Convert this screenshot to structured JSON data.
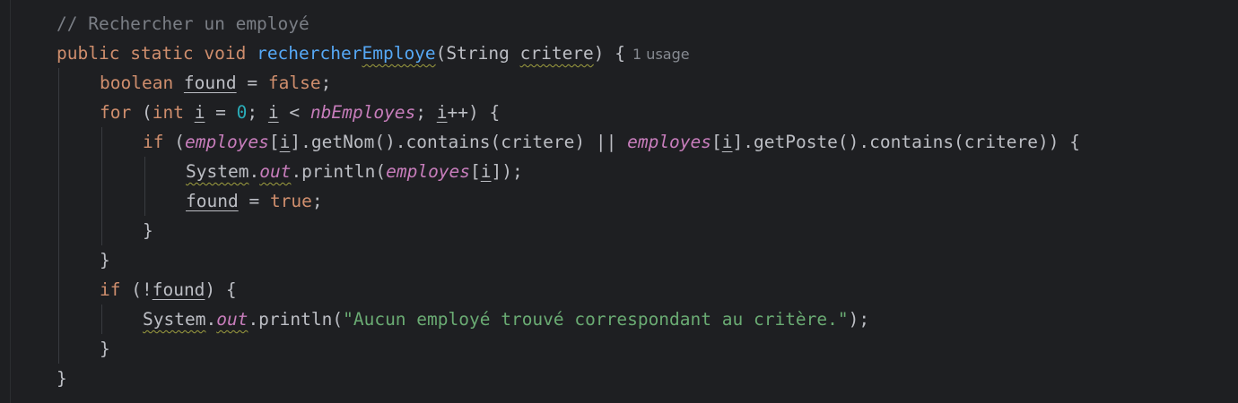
{
  "editor": {
    "usage_hint": "1 usage",
    "lines": [
      {
        "indent": 1,
        "tokens": [
          {
            "t": "// Rechercher un employé",
            "c": "cmt"
          }
        ]
      },
      {
        "indent": 1,
        "tokens": [
          {
            "t": "public ",
            "c": "kw"
          },
          {
            "t": "static ",
            "c": "kw"
          },
          {
            "t": "void ",
            "c": "kw"
          },
          {
            "t": "rechercher",
            "c": "fn"
          },
          {
            "t": "Employe",
            "c": "fn",
            "wavy": true
          },
          {
            "t": "(",
            "c": "txt"
          },
          {
            "t": "String ",
            "c": "txt"
          },
          {
            "t": "critere",
            "c": "txt",
            "wavy": true
          },
          {
            "t": ") {",
            "c": "txt"
          }
        ],
        "hint": true
      },
      {
        "indent": 2,
        "tokens": [
          {
            "t": "boolean ",
            "c": "kw"
          },
          {
            "t": "found",
            "c": "txt",
            "ul": true
          },
          {
            "t": " = ",
            "c": "txt"
          },
          {
            "t": "false",
            "c": "kw"
          },
          {
            "t": ";",
            "c": "txt"
          }
        ]
      },
      {
        "indent": 2,
        "tokens": [
          {
            "t": "for ",
            "c": "kw"
          },
          {
            "t": "(",
            "c": "txt"
          },
          {
            "t": "int ",
            "c": "kw"
          },
          {
            "t": "i",
            "c": "txt",
            "ul": true
          },
          {
            "t": " = ",
            "c": "txt"
          },
          {
            "t": "0",
            "c": "num"
          },
          {
            "t": "; ",
            "c": "txt"
          },
          {
            "t": "i",
            "c": "txt",
            "ul": true
          },
          {
            "t": " < ",
            "c": "txt"
          },
          {
            "t": "nbEmployes",
            "c": "fld"
          },
          {
            "t": "; ",
            "c": "txt"
          },
          {
            "t": "i",
            "c": "txt",
            "ul": true
          },
          {
            "t": "++) {",
            "c": "txt"
          }
        ]
      },
      {
        "indent": 3,
        "tokens": [
          {
            "t": "if ",
            "c": "kw"
          },
          {
            "t": "(",
            "c": "txt"
          },
          {
            "t": "employes",
            "c": "fld"
          },
          {
            "t": "[",
            "c": "txt"
          },
          {
            "t": "i",
            "c": "txt",
            "ul": true
          },
          {
            "t": "].getNom().contains(critere) || ",
            "c": "txt"
          },
          {
            "t": "employes",
            "c": "fld"
          },
          {
            "t": "[",
            "c": "txt"
          },
          {
            "t": "i",
            "c": "txt",
            "ul": true
          },
          {
            "t": "].getPoste().contains(critere)) {",
            "c": "txt"
          }
        ]
      },
      {
        "indent": 4,
        "tokens": [
          {
            "t": "System",
            "c": "txt",
            "wavy": true
          },
          {
            "t": ".",
            "c": "txt"
          },
          {
            "t": "out",
            "c": "fld",
            "wavy": true
          },
          {
            "t": ".println(",
            "c": "txt"
          },
          {
            "t": "employes",
            "c": "fld"
          },
          {
            "t": "[",
            "c": "txt"
          },
          {
            "t": "i",
            "c": "txt",
            "ul": true
          },
          {
            "t": "]);",
            "c": "txt"
          }
        ]
      },
      {
        "indent": 4,
        "tokens": [
          {
            "t": "found",
            "c": "txt",
            "ul": true
          },
          {
            "t": " = ",
            "c": "txt"
          },
          {
            "t": "true",
            "c": "kw"
          },
          {
            "t": ";",
            "c": "txt"
          }
        ]
      },
      {
        "indent": 3,
        "tokens": [
          {
            "t": "}",
            "c": "txt"
          }
        ]
      },
      {
        "indent": 2,
        "tokens": [
          {
            "t": "}",
            "c": "txt"
          }
        ]
      },
      {
        "indent": 2,
        "tokens": [
          {
            "t": "if ",
            "c": "kw"
          },
          {
            "t": "(!",
            "c": "txt"
          },
          {
            "t": "found",
            "c": "txt",
            "ul": true
          },
          {
            "t": ") {",
            "c": "txt"
          }
        ]
      },
      {
        "indent": 3,
        "tokens": [
          {
            "t": "System",
            "c": "txt",
            "wavy": true
          },
          {
            "t": ".",
            "c": "txt"
          },
          {
            "t": "out",
            "c": "fld",
            "wavy": true
          },
          {
            "t": ".println(",
            "c": "txt"
          },
          {
            "t": "\"Aucun employé trouvé correspondant au critère.\"",
            "c": "str"
          },
          {
            "t": ");",
            "c": "txt"
          }
        ]
      },
      {
        "indent": 2,
        "tokens": [
          {
            "t": "}",
            "c": "txt"
          }
        ]
      },
      {
        "indent": 1,
        "tokens": [
          {
            "t": "}",
            "c": "txt"
          }
        ]
      }
    ]
  },
  "colors": {
    "background": "#1e1f22",
    "keyword": "#cf8e6d",
    "comment": "#7a7e85",
    "method": "#56a8f5",
    "field": "#c77dbb",
    "number": "#2aacb8",
    "string": "#6aab73",
    "text": "#bcbec4"
  }
}
